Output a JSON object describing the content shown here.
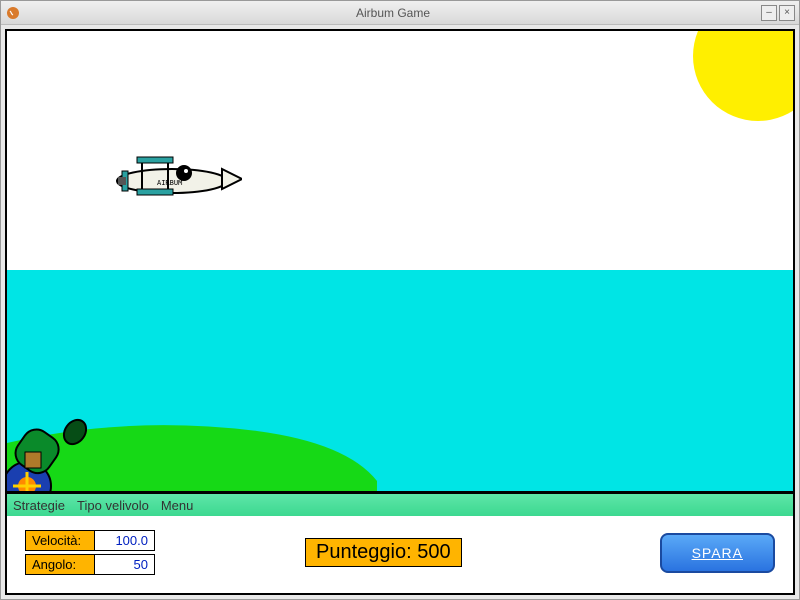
{
  "window": {
    "title": "Airbum Game"
  },
  "menu": {
    "strategies": "Strategie",
    "aircraft_type": "Tipo velivolo",
    "menu": "Menu"
  },
  "params": {
    "velocity_label": "Velocità:",
    "velocity_value": "100.0",
    "angle_label": "Angolo:",
    "angle_value": "50"
  },
  "score": {
    "label": "Punteggio: 500",
    "value": 500
  },
  "fire_button": "SPARA",
  "icons": {
    "minimize": "–",
    "close": "×"
  },
  "colors": {
    "accent": "#ffb400",
    "water": "#00e5e5",
    "land": "#16d916",
    "sun": "#ffef00",
    "button": "#2a73e0"
  }
}
